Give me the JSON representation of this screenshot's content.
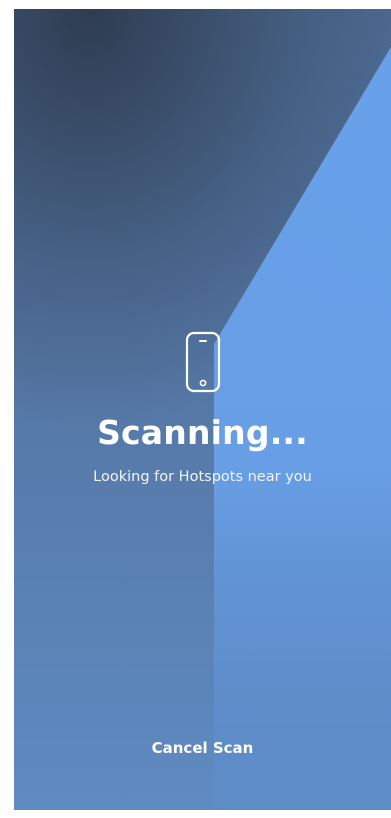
{
  "scan": {
    "title": "Scanning...",
    "subtitle": "Looking for Hotspots near you",
    "cancel_label": "Cancel Scan"
  },
  "icons": {
    "device": "smartphone-icon"
  },
  "colors": {
    "background_dark": "#3b4a63",
    "background_light": "#5f8bc2",
    "beam": "#6ea6ee",
    "text": "#ffffff"
  }
}
